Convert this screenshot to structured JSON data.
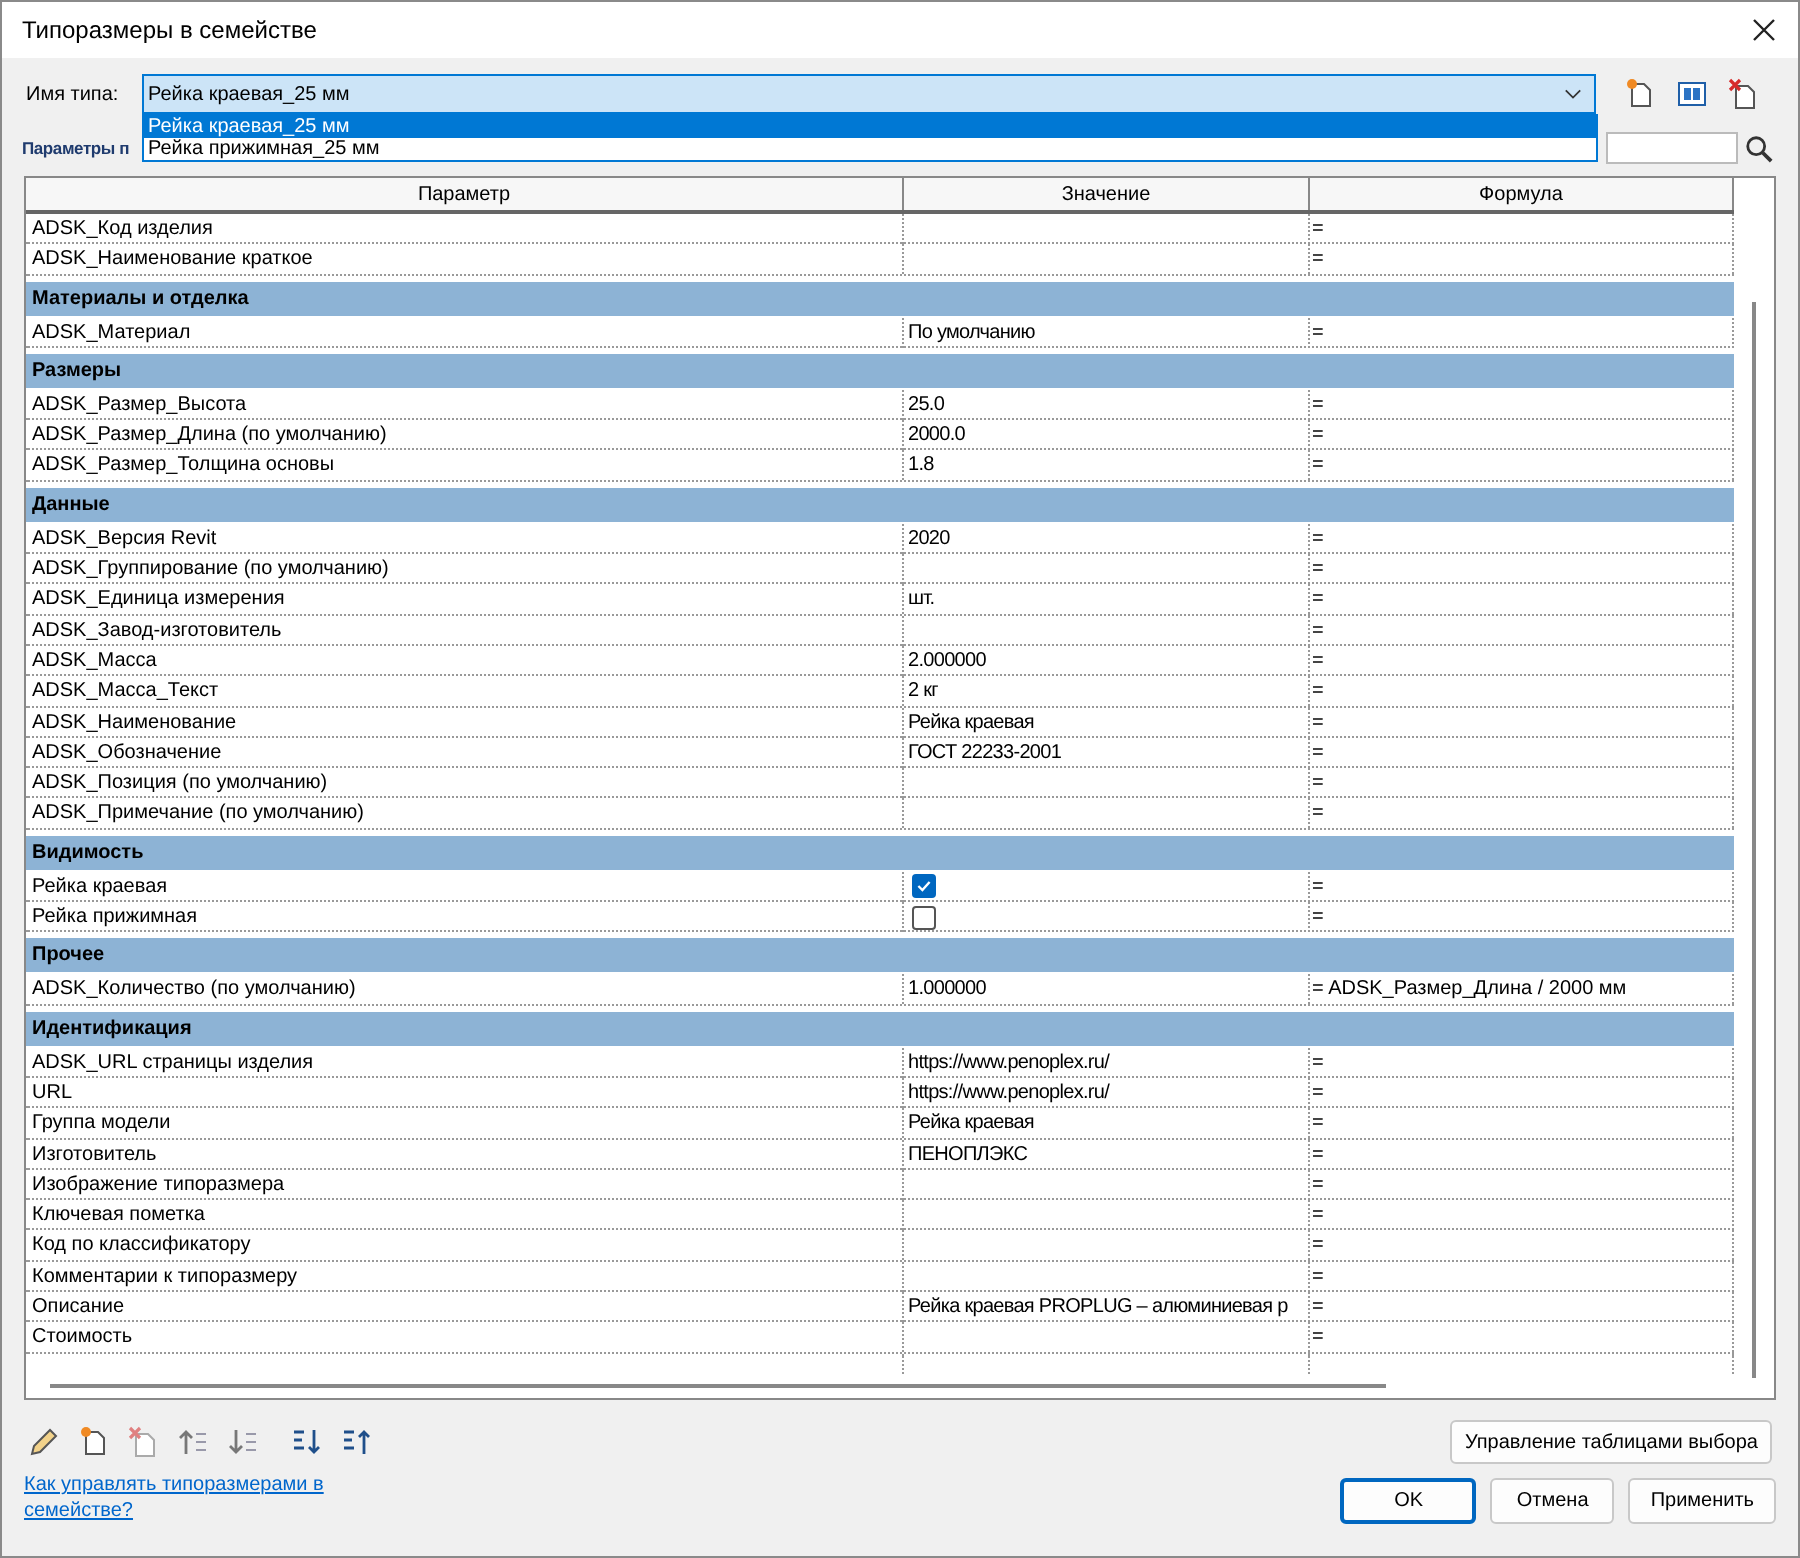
{
  "window": {
    "title": "Типоразмеры в семействе"
  },
  "type_name": {
    "label": "Имя типа:",
    "value": "Рейка краевая_25 мм",
    "expanded": true,
    "options": [
      {
        "label": "Рейка краевая_25 мм",
        "selected": true
      },
      {
        "label": "Рейка прижимная_25 мм",
        "selected": false
      }
    ]
  },
  "parameters_label": "Параметры п",
  "table": {
    "columns": [
      "Параметр",
      "Значение",
      "Формула"
    ],
    "rows": [
      {
        "kind": "param",
        "name": "ADSK_Код изделия",
        "value": "",
        "formula": "="
      },
      {
        "kind": "param",
        "name": "ADSK_Наименование краткое",
        "value": "",
        "formula": "="
      },
      {
        "kind": "group",
        "name": "Материалы и отделка"
      },
      {
        "kind": "param",
        "name": "ADSK_Материал",
        "value": "По умолчанию",
        "formula": "="
      },
      {
        "kind": "group",
        "name": "Размеры"
      },
      {
        "kind": "param",
        "name": "ADSK_Размер_Высота",
        "value": "25.0",
        "formula": "="
      },
      {
        "kind": "param",
        "name": "ADSK_Размер_Длина (по умолчанию)",
        "value": "2000.0",
        "formula": "="
      },
      {
        "kind": "param",
        "name": "ADSK_Размер_Толщина основы",
        "value": "1.8",
        "formula": "="
      },
      {
        "kind": "group",
        "name": "Данные"
      },
      {
        "kind": "param",
        "name": "ADSK_Версия Revit",
        "value": "2020",
        "formula": "="
      },
      {
        "kind": "param",
        "name": "ADSK_Группирование (по умолчанию)",
        "value": "",
        "formula": "="
      },
      {
        "kind": "param",
        "name": "ADSK_Единица измерения",
        "value": "шт.",
        "formula": "="
      },
      {
        "kind": "param",
        "name": "ADSK_Завод-изготовитель",
        "value": "",
        "formula": "="
      },
      {
        "kind": "param",
        "name": "ADSK_Масса",
        "value": "2.000000",
        "formula": "="
      },
      {
        "kind": "param",
        "name": "ADSK_Масса_Текст",
        "value": "2 кг",
        "formula": "="
      },
      {
        "kind": "param",
        "name": "ADSK_Наименование",
        "value": "Рейка краевая",
        "formula": "="
      },
      {
        "kind": "param",
        "name": "ADSK_Обозначение",
        "value": "ГОСТ 22233-2001",
        "formula": "="
      },
      {
        "kind": "param",
        "name": "ADSK_Позиция (по умолчанию)",
        "value": "",
        "formula": "="
      },
      {
        "kind": "param",
        "name": "ADSK_Примечание (по умолчанию)",
        "value": "",
        "formula": "="
      },
      {
        "kind": "group",
        "name": "Видимость"
      },
      {
        "kind": "checkbox",
        "name": "Рейка краевая",
        "checked": true,
        "formula": "="
      },
      {
        "kind": "checkbox",
        "name": "Рейка прижимная",
        "checked": false,
        "formula": "="
      },
      {
        "kind": "group",
        "name": "Прочее"
      },
      {
        "kind": "param",
        "name": "ADSK_Количество (по умолчанию)",
        "value": "1.000000",
        "formula": "= ADSK_Размер_Длина / 2000 мм"
      },
      {
        "kind": "group",
        "name": "Идентификация"
      },
      {
        "kind": "param",
        "name": "ADSK_URL страницы изделия",
        "value": "https://www.penoplex.ru/",
        "formula": "="
      },
      {
        "kind": "param",
        "name": "URL",
        "value": "https://www.penoplex.ru/",
        "formula": "="
      },
      {
        "kind": "param",
        "name": "Группа модели",
        "value": "Рейка краевая",
        "formula": "="
      },
      {
        "kind": "param",
        "name": "Изготовитель",
        "value": "ПЕНОПЛЭКС",
        "formula": "="
      },
      {
        "kind": "param",
        "name": "Изображение типоразмера",
        "value": "",
        "formula": "="
      },
      {
        "kind": "param",
        "name": "Ключевая пометка",
        "value": "",
        "formula": "="
      },
      {
        "kind": "param",
        "name": "Код по классификатору",
        "value": "",
        "formula": "="
      },
      {
        "kind": "param",
        "name": "Комментарии к типоразмеру",
        "value": "",
        "formula": "="
      },
      {
        "kind": "param",
        "name": "Описание",
        "value": "Рейка краевая PROPLUG – алюминиевая р",
        "formula": "="
      },
      {
        "kind": "param",
        "name": "Стоимость",
        "value": "",
        "formula": "="
      }
    ]
  },
  "manage_button": "Управление таблицами выбора",
  "help_link": "Как управлять типоразмерами в семействе?",
  "buttons": [
    {
      "label": "OK",
      "kind": "default"
    },
    {
      "label": "Отмена",
      "kind": "normal"
    },
    {
      "label": "Применить",
      "kind": "normal"
    }
  ]
}
